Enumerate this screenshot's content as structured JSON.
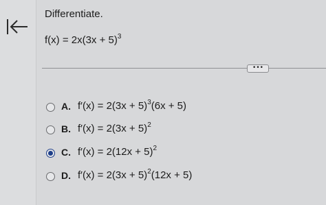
{
  "prompt": "Differentiate.",
  "function": {
    "base": "f(x) = 2x(3x + 5)",
    "exp": "3"
  },
  "more_label": "•••",
  "options": [
    {
      "letter": "A.",
      "pre": "f′(x) = 2(3x + 5)",
      "exp": "3",
      "post": "(6x + 5)",
      "selected": false
    },
    {
      "letter": "B.",
      "pre": "f′(x) = 2(3x + 5)",
      "exp": "2",
      "post": "",
      "selected": false
    },
    {
      "letter": "C.",
      "pre": "f′(x) = 2(12x + 5)",
      "exp": "2",
      "post": "",
      "selected": true
    },
    {
      "letter": "D.",
      "pre": "f′(x) = 2(3x + 5)",
      "exp": "2",
      "post": "(12x + 5)",
      "selected": false
    }
  ],
  "colors": {
    "selected_radio": "#1e3f8a",
    "background": "#d7d8da"
  },
  "icons": {
    "back": "arrow-left-to-bar-icon"
  }
}
